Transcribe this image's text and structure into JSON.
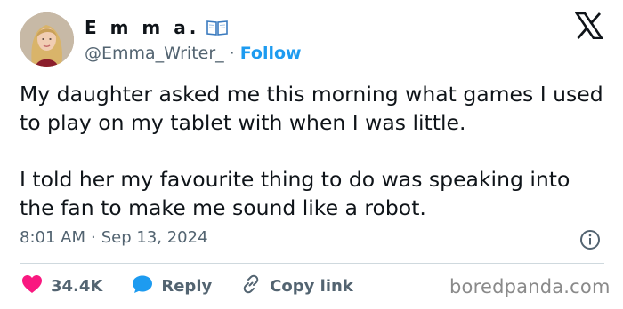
{
  "author": {
    "display_name": "E m m a.",
    "name_emoji_icon": "open-book-icon",
    "handle": "@Emma_Writer_",
    "separator": "·",
    "follow_label": "Follow"
  },
  "tweet": {
    "text": "My daughter asked me this morning what games I used to play on my tablet with when I was little.\n\nI told her my favourite thing to do was  speaking into the fan to make me sound like a robot.",
    "time": "8:01 AM",
    "separator": "·",
    "date": "Sep 13, 2024"
  },
  "actions": {
    "like_count": "34.4K",
    "reply_label": "Reply",
    "copy_link_label": "Copy link"
  },
  "watermark": "boredpanda.com",
  "colors": {
    "link_blue": "#1d9bf0",
    "like_pink": "#f91880",
    "reply_blue": "#1d9bf0",
    "text_primary": "#0f1419",
    "text_secondary": "#536471"
  }
}
